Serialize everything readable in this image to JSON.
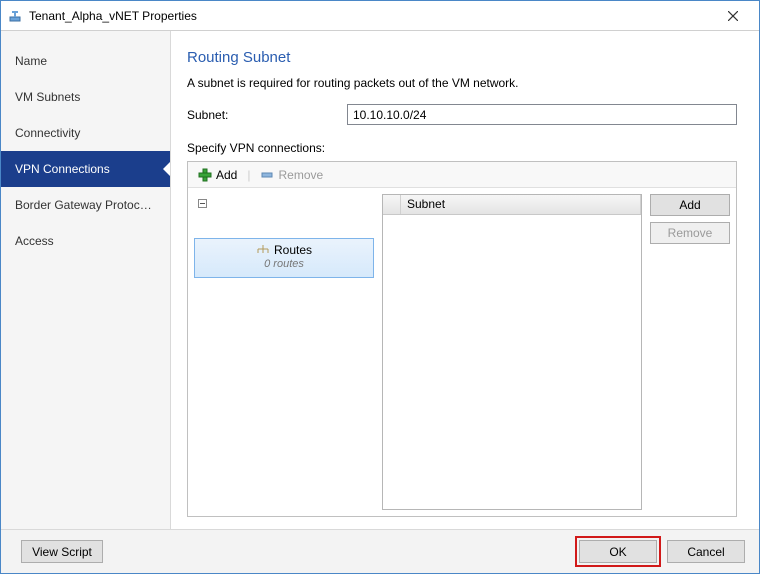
{
  "window": {
    "title": "Tenant_Alpha_vNET Properties"
  },
  "sidebar": {
    "items": [
      {
        "label": "Name"
      },
      {
        "label": "VM Subnets"
      },
      {
        "label": "Connectivity"
      },
      {
        "label": "VPN Connections"
      },
      {
        "label": "Border Gateway Protocol..."
      },
      {
        "label": "Access"
      }
    ]
  },
  "main": {
    "title": "Routing Subnet",
    "description": "A subnet is required for routing packets out of the VM network.",
    "subnet_label": "Subnet:",
    "subnet_value": "10.10.10.0/24",
    "specify_label": "Specify VPN connections:",
    "toolbar": {
      "add_label": "Add",
      "remove_label": "Remove"
    },
    "routes": {
      "title": "Routes",
      "subtitle": "0 routes"
    },
    "grid": {
      "header_subnet": "Subnet"
    },
    "buttons": {
      "add": "Add",
      "remove": "Remove"
    }
  },
  "footer": {
    "view_script": "View Script",
    "ok": "OK",
    "cancel": "Cancel"
  }
}
